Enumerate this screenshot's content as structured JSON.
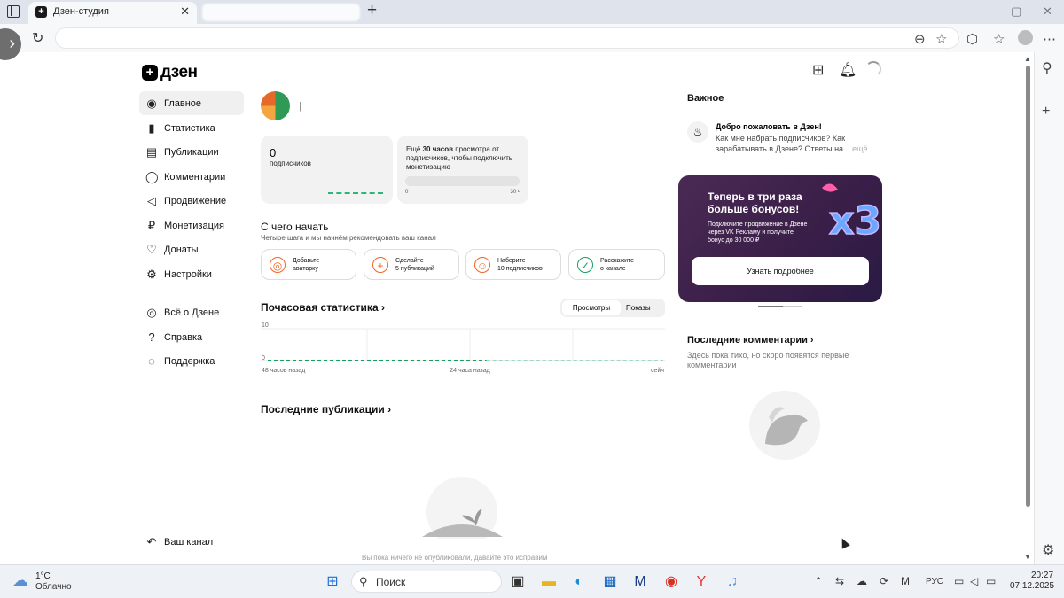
{
  "browser": {
    "tab_title": "Дзен-студия",
    "tab_close": "✕",
    "new_tab": "+",
    "window_controls": [
      "—",
      "▢",
      "✕"
    ]
  },
  "site": {
    "logo": "дзен",
    "nav": [
      {
        "label": "Главное",
        "icon": "home-icon",
        "glyph": "◉",
        "active": true
      },
      {
        "label": "Статистика",
        "icon": "stats-icon",
        "glyph": "▮",
        "active": false
      },
      {
        "label": "Публикации",
        "icon": "publications-icon",
        "glyph": "▤",
        "active": false
      },
      {
        "label": "Комментарии",
        "icon": "comments-icon",
        "glyph": "◯",
        "active": false
      },
      {
        "label": "Продвижение",
        "icon": "megaphone-icon",
        "glyph": "◁",
        "active": false
      },
      {
        "label": "Монетизация",
        "icon": "ruble-icon",
        "glyph": "₽",
        "active": false
      },
      {
        "label": "Донаты",
        "icon": "donate-icon",
        "glyph": "♡",
        "active": false
      },
      {
        "label": "Настройки",
        "icon": "gear-icon",
        "glyph": "⚙",
        "active": false
      }
    ],
    "nav2": [
      {
        "label": "Всё о Дзене",
        "icon": "planet-icon",
        "glyph": "◎"
      },
      {
        "label": "Справка",
        "icon": "help-icon",
        "glyph": "?"
      },
      {
        "label": "Поддержка",
        "icon": "support-icon",
        "glyph": "◌"
      }
    ],
    "your_channel": "Ваш канал",
    "channel_name": "|"
  },
  "stats": {
    "subscribers_count": "0",
    "subscribers_label": "подписчиков",
    "monetization_prefix": "Ещё ",
    "monetization_hours": "30 часов",
    "monetization_suffix": " просмотра от подписчиков, чтобы подключить монетизацию",
    "progress_min": "0",
    "progress_max": "30 ч",
    "progress_value": 0
  },
  "start": {
    "title": "С чего начать",
    "subtitle": "Четыре шага и мы начнём рекомендовать ваш канал",
    "steps": [
      {
        "line1": "Добавьте",
        "line2": "аватарку",
        "icon": "camera-icon",
        "glyph": "◎",
        "color": "#f26522"
      },
      {
        "line1": "Сделайте",
        "line2": "5 публикаций",
        "icon": "plus-square-icon",
        "glyph": "+",
        "color": "#f26522"
      },
      {
        "line1": "Наберите",
        "line2": "10 подписчиков",
        "icon": "users-icon",
        "glyph": "☺",
        "color": "#f26522"
      },
      {
        "line1": "Расскажите",
        "line2": "о канале",
        "icon": "check-circle-icon",
        "glyph": "✓",
        "color": "#1a9e5c"
      }
    ]
  },
  "hourly": {
    "title": "Почасовая статистика",
    "toggle_views": "Просмотры",
    "toggle_impressions": "Показы",
    "y_max": "10",
    "y_min": "0",
    "x_labels": [
      "48 часов назад",
      "24 часа назад",
      "сейч"
    ]
  },
  "chart_data": {
    "type": "line",
    "title": "Почасовая статистика",
    "x_labels": [
      "48 часов назад",
      "24 часа назад",
      "сейч"
    ],
    "ylim": [
      0,
      10
    ],
    "series": [
      {
        "values": [
          0,
          0,
          0,
          0,
          0,
          0,
          0,
          0,
          0,
          0,
          0,
          0,
          0,
          0,
          0,
          0,
          0,
          0,
          0,
          0,
          0,
          0,
          0,
          0,
          0,
          0,
          0,
          0,
          0,
          0,
          0,
          0,
          0,
          0,
          0,
          0,
          0,
          0,
          0,
          0,
          0,
          0,
          0,
          0,
          0,
          0,
          0,
          0
        ]
      }
    ],
    "grid": true
  },
  "recent_pubs": {
    "title": "Последние публикации",
    "empty": "Вы пока ничего не опубликовали, давайте это исправим"
  },
  "important": {
    "title": "Важное",
    "welcome_title": "Добро пожаловать в Дзен!",
    "welcome_text": "Как мне набрать подписчиков? Как зарабатывать в Дзене? Ответы на...",
    "welcome_more": " ещё"
  },
  "promo": {
    "title": "Теперь в три раза больше бонусов!",
    "text": "Подключите продвижение в Дзене через VK Рекламу и получите бонус до 30 000 ₽",
    "button": "Узнать подробнее"
  },
  "comments": {
    "title": "Последние комментарии",
    "empty": "Здесь пока тихо, но скоро появятся первые комментарии"
  },
  "taskbar": {
    "temp": "1°C",
    "weather": "Облачно",
    "search": "Поиск",
    "lang": "РУС",
    "time": "20:27",
    "date": "07.12.2025"
  }
}
